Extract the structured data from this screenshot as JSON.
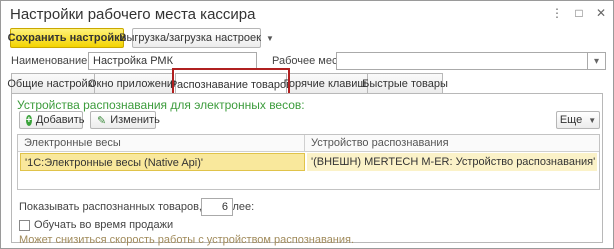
{
  "window": {
    "title": "Настройки рабочего места кассира",
    "controls": [
      "⋮",
      "□",
      "✕"
    ]
  },
  "toolbar": {
    "save_label": "Сохранить настройки",
    "export_label": "Выгрузка/загрузка настроек"
  },
  "fields": {
    "name_label": "Наименование:",
    "name_value": "Настройка РМК",
    "workplace_label": "Рабочее место:",
    "workplace_value": ""
  },
  "tabs": [
    {
      "label": "Общие настройки"
    },
    {
      "label": "Окно приложения"
    },
    {
      "label": "Распознавание товаров"
    },
    {
      "label": "Горячие клавиши"
    },
    {
      "label": "Быстрые товары"
    }
  ],
  "panel": {
    "section_title": "Устройства распознавания для электронных весов:",
    "add_label": "Добавить",
    "edit_label": "Изменить",
    "more_label": "Еще",
    "table": {
      "columns": [
        "Электронные весы",
        "Устройство распознавания"
      ],
      "rows": [
        [
          "'1С:Электронные весы (Native Api)'",
          "'(ВНЕШН) MERTECH M-ER: Устройство распознавания'"
        ]
      ]
    },
    "show_count_label": "Показывать распознанных товаров, не более:",
    "show_count_value": "6",
    "learn_label": "Обучать во время продажи",
    "warning": "Может снизиться скорость работы с устройством распознавания."
  },
  "colors": {
    "accent_green": "#3c9c3c",
    "primary_button": "#f3d300",
    "highlight_border": "#b02020",
    "selected_row": "#f9e89c"
  }
}
